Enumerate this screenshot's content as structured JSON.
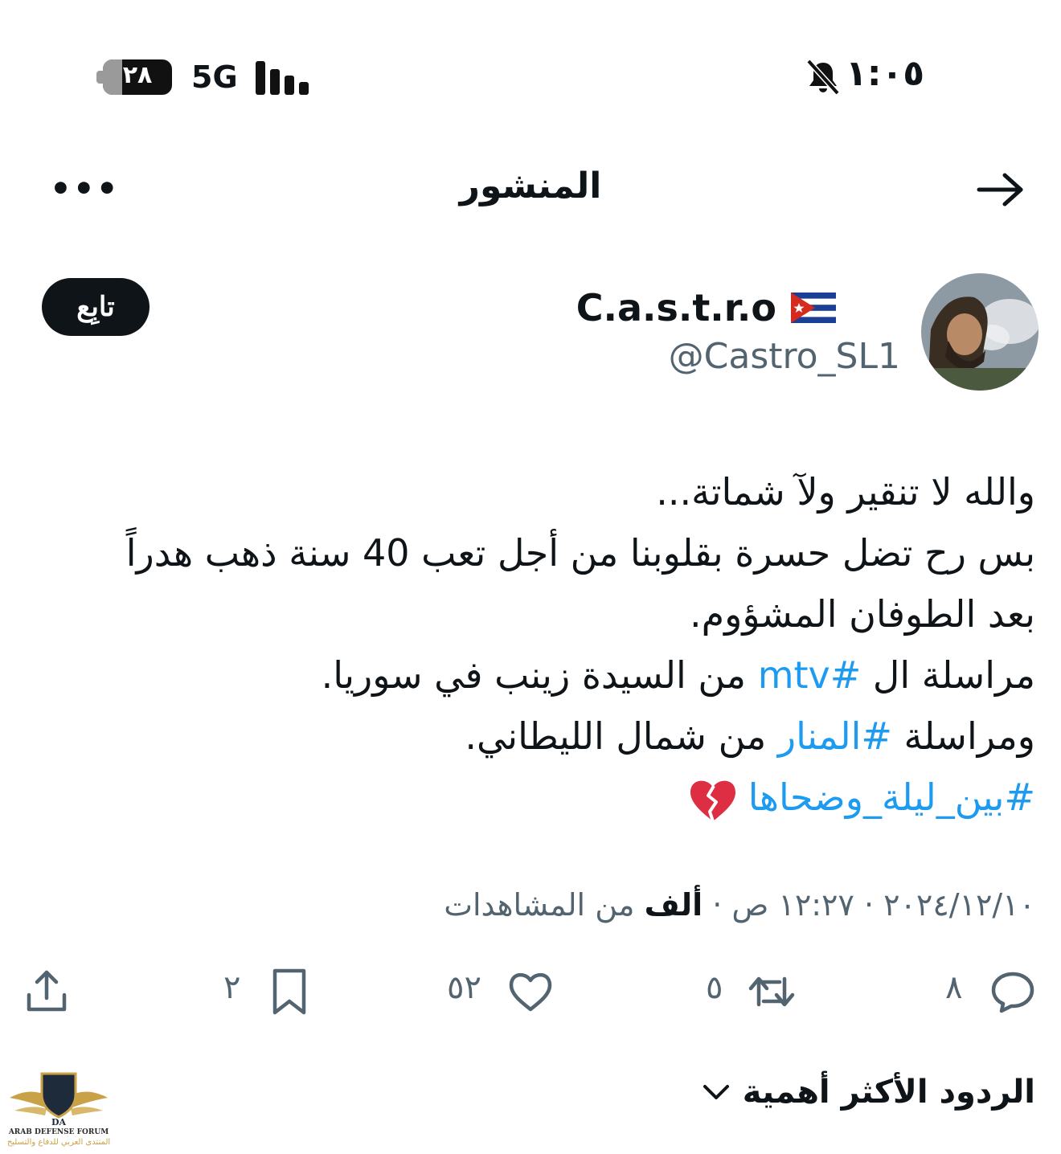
{
  "status_bar": {
    "time": "١:٠٥",
    "network": "5G",
    "battery_level": "٢٨",
    "battery_fraction": 0.28,
    "icons": [
      "bell-slash-icon",
      "signal-icon",
      "battery-icon"
    ]
  },
  "header": {
    "title": "المنشور",
    "more_label": "•••",
    "icons": [
      "back-arrow-icon",
      "more-icon"
    ]
  },
  "author": {
    "name": "C.a.s.t.r.o",
    "flag": "🇨🇺",
    "handle": "@Castro_SL1",
    "follow_label": "تابِع"
  },
  "tweet": {
    "lines": [
      [
        {
          "text": "والله لا تنقير ولآ شماتة..."
        }
      ],
      [
        {
          "text": "بس رح تضل حسرة بقلوبنا من أجل تعب 40 سنة ذهب هدراً"
        }
      ],
      [
        {
          "text": "بعد الطوفان المشؤوم."
        }
      ],
      [
        {
          "text": "مراسلة ال "
        },
        {
          "text": "#mtv",
          "link": true
        },
        {
          "text": " من السيدة زينب في سوريا."
        }
      ],
      [
        {
          "text": "ومراسلة "
        },
        {
          "text": "#المنار",
          "link": true
        },
        {
          "text": " من شمال الليطاني."
        }
      ],
      [
        {
          "text": "#بين_ليلة_وضحاها",
          "link": true
        }
      ]
    ],
    "trailing_emoji": "broken-heart-icon",
    "link_color": "#1d9bf0"
  },
  "meta": {
    "date": "٢٠٢٤/١٢/١٠",
    "sep": " · ",
    "time": "١٢:٢٧ ص",
    "views_count": "ألف",
    "views_label": " من المشاهدات"
  },
  "actions": {
    "replies": "٨",
    "reposts": "٥",
    "likes": "٥٢",
    "bookmarks": "٢",
    "icons": [
      "reply-icon",
      "repost-icon",
      "like-icon",
      "bookmark-icon",
      "share-icon"
    ]
  },
  "replies_sort": {
    "label": "الردود الأكثر أهمية"
  },
  "watermark": {
    "line1": "ARAB DEFENSE FORUM",
    "line2": "المنتدى العربي للدفاع والتسليح",
    "logo_text": "DA"
  },
  "colors": {
    "text": "#0f1419",
    "muted": "#536471",
    "accent": "#1d9bf0",
    "cuba_red": "#d52b1e",
    "cuba_blue": "#1b3f94"
  }
}
